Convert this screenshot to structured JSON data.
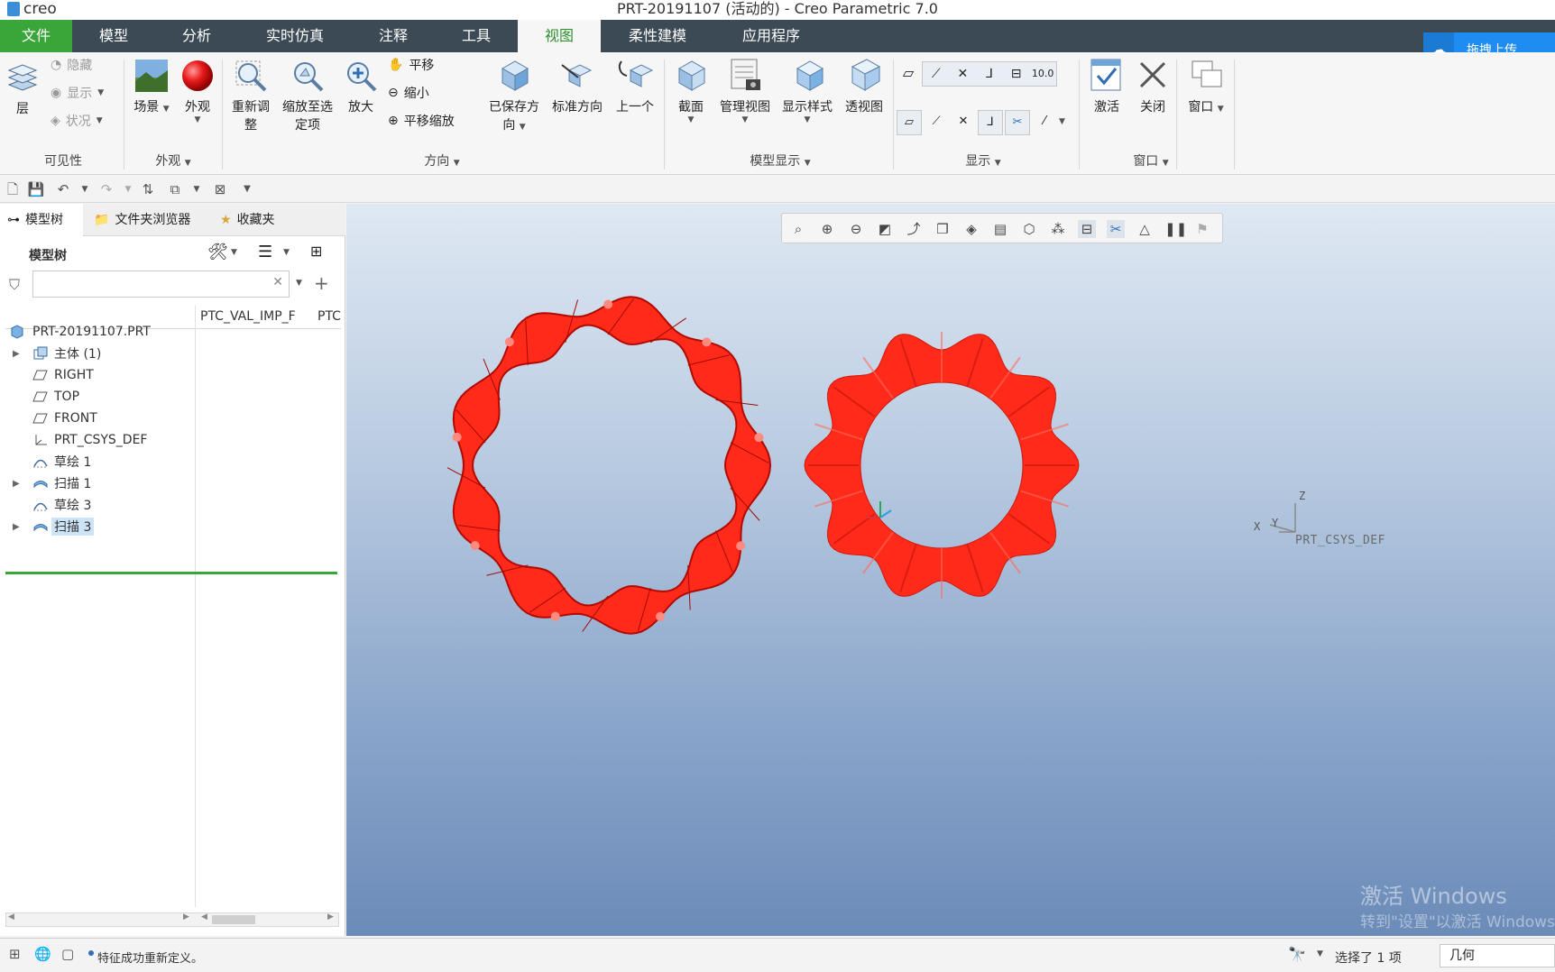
{
  "window": {
    "app_logo": "creo",
    "title": "PRT-20191107 (活动的) - Creo Parametric 7.0"
  },
  "menu": {
    "tabs": [
      "文件",
      "模型",
      "分析",
      "实时仿真",
      "注释",
      "工具",
      "视图",
      "柔性建模",
      "应用程序"
    ],
    "active": "视图",
    "upload_label": "拖拽上传"
  },
  "ribbon": {
    "visibility": {
      "layer": "层",
      "hide": "隐藏",
      "show": "显示",
      "status": "状况",
      "group": "可见性"
    },
    "appearance": {
      "scene": "场景",
      "appearance": "外观",
      "group": "外观"
    },
    "orientation": {
      "refit_line1": "重新调",
      "refit_line2": "整",
      "zoom_to_line1": "缩放至选",
      "zoom_to_line2": "定项",
      "zoom_in": "放大",
      "pan": "平移",
      "zoom_out": "缩小",
      "pan_zoom": "平移缩放",
      "saved_line1": "已保存方",
      "saved_line2": "向",
      "standard": "标准方向",
      "previous": "上一个",
      "group": "方向"
    },
    "model_display": {
      "section": "截面",
      "manage_views": "管理视图",
      "display_style": "显示样式",
      "perspective": "透视图",
      "group": "模型显示"
    },
    "show": {
      "group": "显示"
    },
    "window": {
      "activate": "激活",
      "close": "关闭",
      "windows": "窗口",
      "group": "窗口"
    },
    "colors": {
      "accent_green": "#3aa63a",
      "menubar": "#3c4a55"
    }
  },
  "left_panel": {
    "tabs": [
      "模型树",
      "文件夹浏览器",
      "收藏夹"
    ],
    "tree_label": "模型树",
    "search_placeholder": "",
    "columns": [
      "PTC_VAL_IMP_F",
      "PTC"
    ],
    "tree": [
      {
        "label": "PRT-20191107.PRT",
        "icon": "part-icon",
        "expandable": false,
        "root": true
      },
      {
        "label": "主体 (1)",
        "icon": "body-icon",
        "expandable": true
      },
      {
        "label": "RIGHT",
        "icon": "datum-plane-icon",
        "expandable": false
      },
      {
        "label": "TOP",
        "icon": "datum-plane-icon",
        "expandable": false
      },
      {
        "label": "FRONT",
        "icon": "datum-plane-icon",
        "expandable": false
      },
      {
        "label": "PRT_CSYS_DEF",
        "icon": "csys-icon",
        "expandable": false
      },
      {
        "label": "草绘 1",
        "icon": "sketch-icon",
        "expandable": false
      },
      {
        "label": "扫描 1",
        "icon": "sweep-icon",
        "expandable": true
      },
      {
        "label": "草绘 3",
        "icon": "sketch-icon",
        "expandable": false
      },
      {
        "label": "扫描 3",
        "icon": "sweep-icon",
        "expandable": true,
        "selected": true
      }
    ]
  },
  "viewport": {
    "csys_label": "PRT_CSYS_DEF",
    "axes": {
      "x": "X",
      "y": "Y",
      "z": "Z"
    },
    "model_color": "#ff2a1a",
    "watermark_line1": "激活 Windows",
    "watermark_line2": "转到\"设置\"以激活 Windows。"
  },
  "status": {
    "message": "特征成功重新定义。",
    "selection": "选择了 1 项",
    "filter": "几何"
  }
}
